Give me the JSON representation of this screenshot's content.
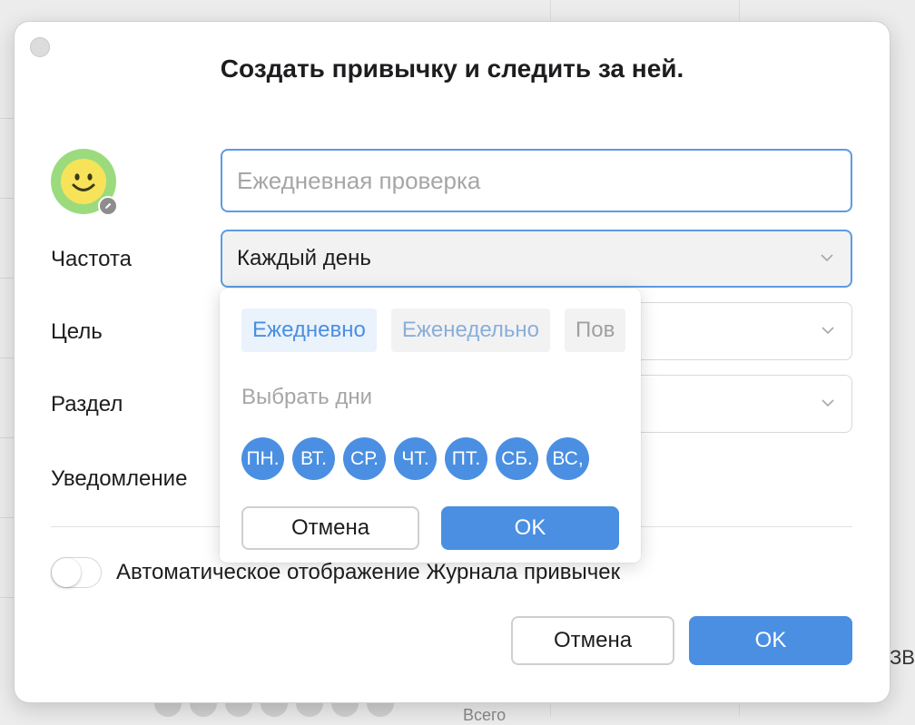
{
  "background": {
    "right_edge_text": "ЗВ",
    "bottom_text": "Всего"
  },
  "dialog": {
    "title": "Создать привычку и следить за ней.",
    "name_input": {
      "value": "",
      "placeholder": "Ежедневная проверка"
    },
    "avatar_icon": "smiley-face-icon",
    "fields": {
      "frequency_label": "Частота",
      "frequency_value": "Каждый день",
      "goal_label": "Цель",
      "section_label": "Раздел",
      "reminder_label": "Уведомление"
    },
    "auto_show_toggle": {
      "label": "Автоматическое отображение Журнала привычек",
      "checked": false
    },
    "cancel_label": "Отмена",
    "ok_label": "OK"
  },
  "frequency_popup": {
    "tabs": [
      {
        "label": "Ежедневно",
        "selected": true
      },
      {
        "label": "Еженедельно",
        "selected": false
      },
      {
        "label": "Пов",
        "selected": false
      }
    ],
    "choose_days_label": "Выбрать дни",
    "days": [
      "ПН.",
      "ВТ.",
      "СР.",
      "ЧТ.",
      "ПТ.",
      "СБ.",
      "ВС,"
    ],
    "cancel_label": "Отмена",
    "ok_label": "OK"
  },
  "colors": {
    "accent": "#4a8fe2",
    "focus_border": "#5b9be4",
    "avatar_bg": "#9bdb7e",
    "smiley": "#f7e35a"
  }
}
